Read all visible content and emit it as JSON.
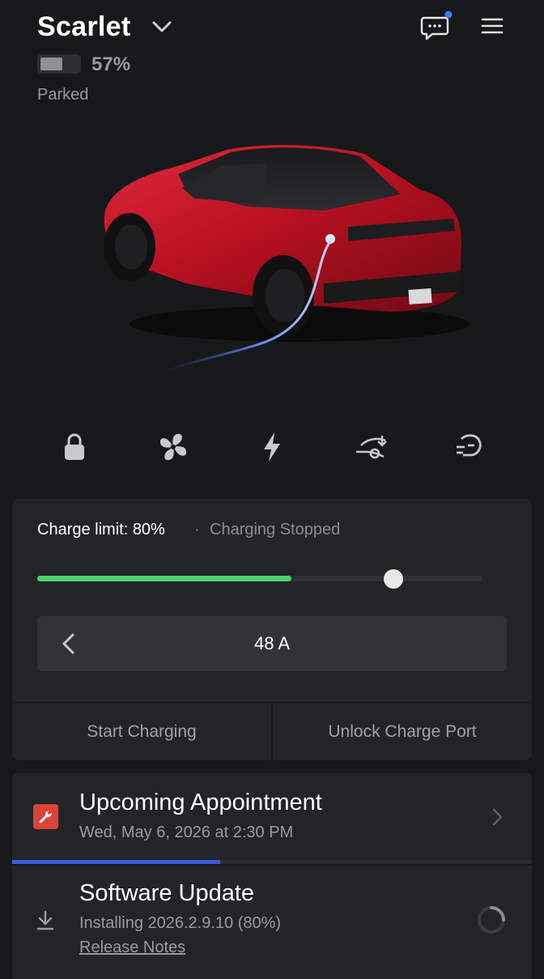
{
  "header": {
    "vehicle_name": "Scarlet",
    "battery_percent": "57%",
    "status": "Parked"
  },
  "icons": {
    "title_chevron": "chevron-down-icon",
    "messages": "chat-bubble-icon",
    "menu": "hamburger-menu-icon"
  },
  "quick_controls": [
    {
      "name": "lock",
      "icon": "lock-icon"
    },
    {
      "name": "climate",
      "icon": "fan-icon"
    },
    {
      "name": "charging",
      "icon": "lightning-icon"
    },
    {
      "name": "frunk",
      "icon": "frunk-icon"
    },
    {
      "name": "summon",
      "icon": "summon-icon"
    }
  ],
  "charging": {
    "limit_label": "Charge limit: 80%",
    "separator": "·",
    "state": "Charging Stopped",
    "current_level": 0.57,
    "limit_level": 0.8,
    "amps": "48 A",
    "start_label": "Start Charging",
    "unlock_label": "Unlock Charge Port"
  },
  "appointment": {
    "title": "Upcoming Appointment",
    "datetime": "Wed, May 6, 2026 at 2:30 PM"
  },
  "software_update": {
    "title": "Software Update",
    "status": "Installing 2026.2.9.10 (80%)",
    "link": "Release Notes",
    "progress": 0.4
  },
  "colors": {
    "background": "#17181a",
    "card": "#232427",
    "charge_fill": "#4fd16f",
    "progress_blue": "#3a5bd9",
    "wrench_red": "#d9443a",
    "car_red": "#c8102e"
  }
}
